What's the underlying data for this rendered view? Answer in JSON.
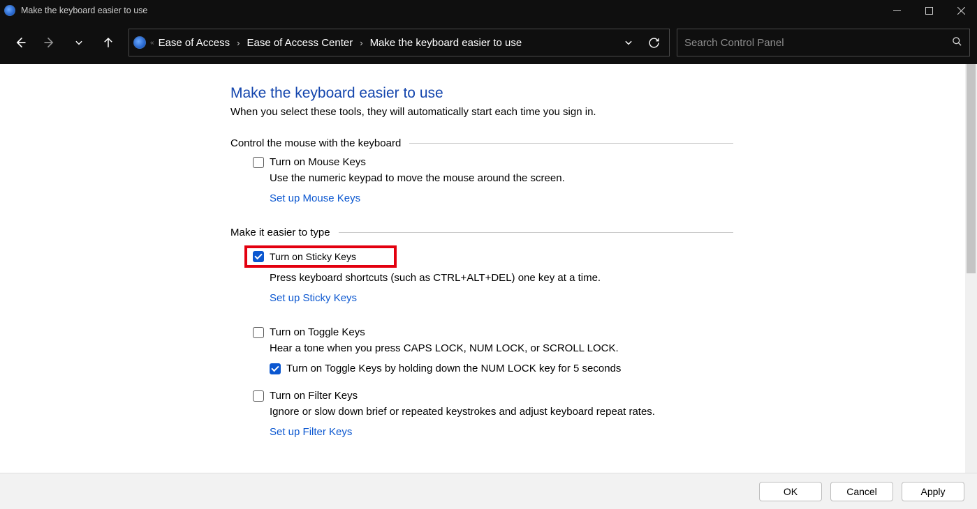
{
  "window": {
    "title": "Make the keyboard easier to use"
  },
  "breadcrumb": {
    "seg1": "Ease of Access",
    "seg2": "Ease of Access Center",
    "seg3": "Make the keyboard easier to use"
  },
  "search": {
    "placeholder": "Search Control Panel"
  },
  "page": {
    "heading": "Make the keyboard easier to use",
    "subtitle": "When you select these tools, they will automatically start each time you sign in.",
    "section_mouse": {
      "title": "Control the mouse with the keyboard",
      "cb_label": "Turn on Mouse Keys",
      "desc": "Use the numeric keypad to move the mouse around the screen.",
      "link": "Set up Mouse Keys",
      "checked": false
    },
    "section_type": {
      "title": "Make it easier to type",
      "sticky": {
        "label": "Turn on Sticky Keys",
        "desc": "Press keyboard shortcuts (such as CTRL+ALT+DEL) one key at a time.",
        "link": "Set up Sticky Keys",
        "checked": true
      },
      "toggle": {
        "label": "Turn on Toggle Keys",
        "desc": "Hear a tone when you press CAPS LOCK, NUM LOCK, or SCROLL LOCK.",
        "sub_label": "Turn on Toggle Keys by holding down the NUM LOCK key for 5 seconds",
        "checked": false,
        "sub_checked": true
      },
      "filter": {
        "label": "Turn on Filter Keys",
        "desc": "Ignore or slow down brief or repeated keystrokes and adjust keyboard repeat rates.",
        "link": "Set up Filter Keys",
        "checked": false
      }
    }
  },
  "footer": {
    "ok": "OK",
    "cancel": "Cancel",
    "apply": "Apply"
  }
}
